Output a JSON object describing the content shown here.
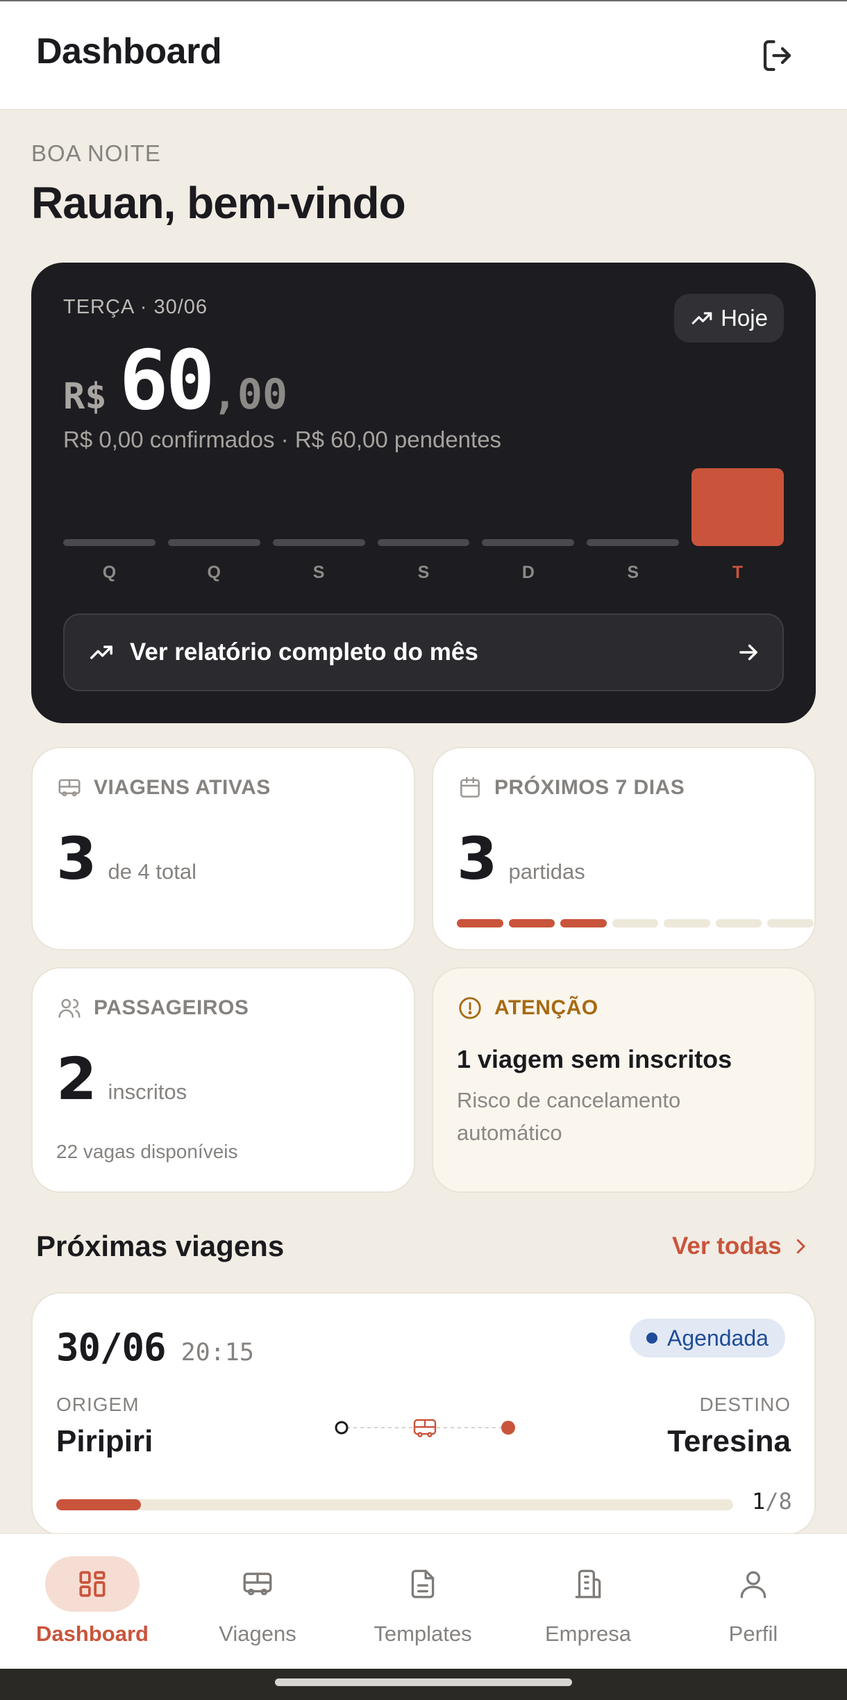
{
  "header": {
    "title": "Dashboard",
    "logout_icon": "logout-icon"
  },
  "greeting": {
    "small": "BOA NOITE",
    "big": "Rauan, bem-vindo"
  },
  "hero": {
    "date": "TERÇA · 30/06",
    "today_label": "Hoje",
    "currency": "R$",
    "amount_int": "60",
    "amount_dec": ",00",
    "subtitle": "R$ 0,00 confirmados · R$ 60,00 pendentes",
    "report_label": "Ver relatório completo do mês"
  },
  "chart_data": {
    "type": "bar",
    "categories": [
      "Q",
      "Q",
      "S",
      "S",
      "D",
      "S",
      "T"
    ],
    "values": [
      0,
      0,
      0,
      0,
      0,
      0,
      60
    ],
    "highlight_index": 6,
    "ylim": [
      0,
      60
    ]
  },
  "stats": {
    "active": {
      "label": "VIAGENS ATIVAS",
      "value": "3",
      "unit": "de 4 total",
      "icon": "bus-icon"
    },
    "next7": {
      "label": "PRÓXIMOS 7 DIAS",
      "value": "3",
      "unit": "partidas",
      "icon": "calendar-icon",
      "segments_total": 7,
      "segments_on": 3
    },
    "passengers": {
      "label": "PASSAGEIROS",
      "value": "2",
      "unit": "inscritos",
      "note": "22 vagas disponíveis",
      "icon": "users-icon"
    },
    "attention": {
      "label": "ATENÇÃO",
      "title": "1 viagem sem inscritos",
      "desc": "Risco de cancelamento automático",
      "icon": "alert-circle-icon"
    }
  },
  "upcoming": {
    "title": "Próximas viagens",
    "see_all": "Ver todas",
    "trips": [
      {
        "date": "30/06",
        "time": "20:15",
        "status": "Agendada",
        "origin_label": "ORIGEM",
        "origin": "Piripiri",
        "dest_label": "DESTINO",
        "dest": "Teresina",
        "booked": "1",
        "capacity": "/8",
        "fill_fraction": 0.125
      }
    ]
  },
  "nav": [
    {
      "label": "Dashboard",
      "icon": "dashboard-icon",
      "active": true
    },
    {
      "label": "Viagens",
      "icon": "bus-icon",
      "active": false
    },
    {
      "label": "Templates",
      "icon": "document-icon",
      "active": false
    },
    {
      "label": "Empresa",
      "icon": "building-icon",
      "active": false
    },
    {
      "label": "Perfil",
      "icon": "user-icon",
      "active": false
    }
  ],
  "colors": {
    "accent": "#C9543B",
    "dark": "#1D1C20",
    "background": "#F1ECE4",
    "info": "#1F4C98",
    "warning": "#A66A12"
  }
}
